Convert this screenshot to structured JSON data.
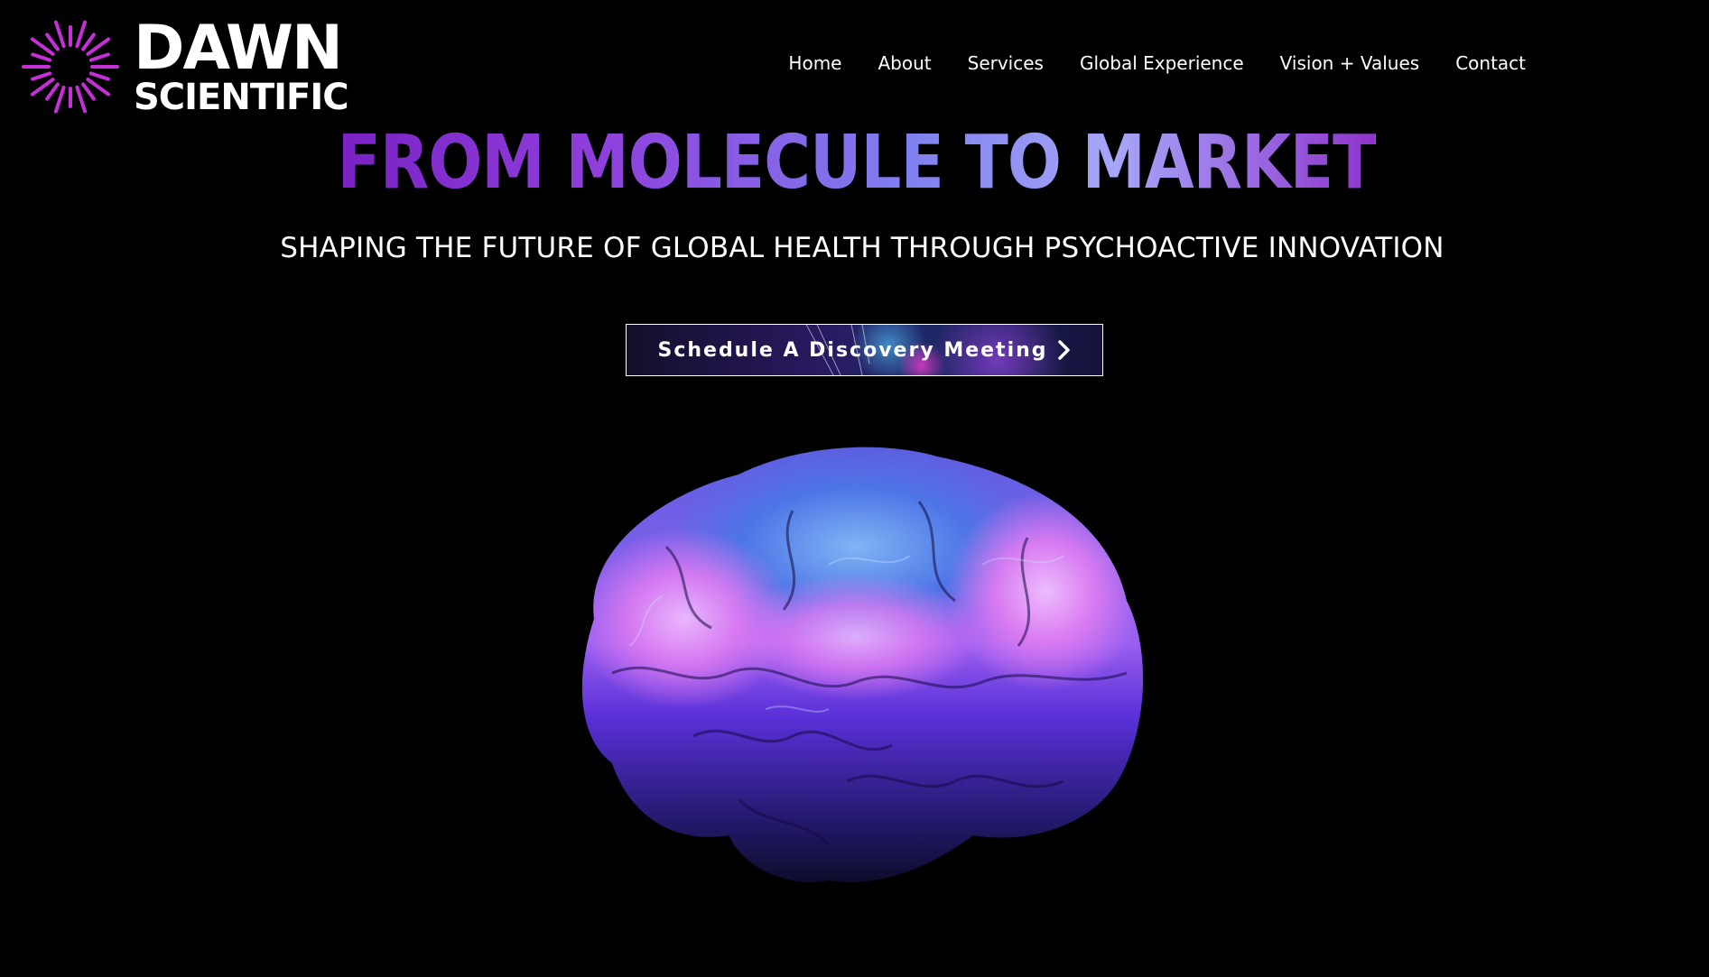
{
  "brand": {
    "line1": "DAWN",
    "line2": "SCIENTIFIC",
    "logo_icon": "sunburst-icon",
    "accent_color": "#c42fd6"
  },
  "nav": {
    "items": [
      {
        "label": "Home"
      },
      {
        "label": "About"
      },
      {
        "label": "Services"
      },
      {
        "label": "Global Experience"
      },
      {
        "label": "Vision + Values"
      },
      {
        "label": "Contact"
      }
    ]
  },
  "hero": {
    "title": "FROM MOLECULE TO MARKET",
    "subtitle": "SHAPING THE FUTURE OF GLOBAL HEALTH THROUGH PSYCHOACTIVE INNOVATION",
    "cta_label": "Schedule A Discovery Meeting",
    "cta_icon": "chevron-right-icon",
    "image": "glowing-brain-image",
    "title_gradient": [
      "#7a22c4",
      "#7f7fef",
      "#8e33cc"
    ]
  }
}
